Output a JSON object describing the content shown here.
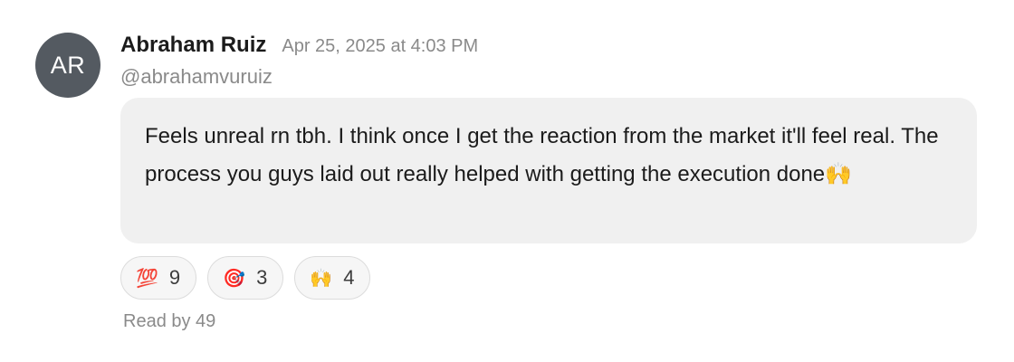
{
  "author": {
    "initials": "AR",
    "name": "Abraham Ruiz",
    "handle": "@abrahamvuruiz"
  },
  "message": {
    "timestamp": "Apr 25, 2025 at 4:03 PM",
    "text": "Feels unreal rn tbh. I think once I get the reaction from the market it'll feel real. The process you guys laid out really helped with getting the execution done🙌"
  },
  "reactions": [
    {
      "emoji": "💯",
      "icon": "hundred-points-icon",
      "count": "9"
    },
    {
      "emoji": "🎯",
      "icon": "direct-hit-icon",
      "count": "3"
    },
    {
      "emoji": "🙌",
      "icon": "raising-hands-icon",
      "count": "4"
    }
  ],
  "read_by": "Read by 49",
  "colors": {
    "avatar_bg": "#545a61",
    "bubble_bg": "#f0f0f0",
    "muted_text": "#8a8a8a"
  }
}
